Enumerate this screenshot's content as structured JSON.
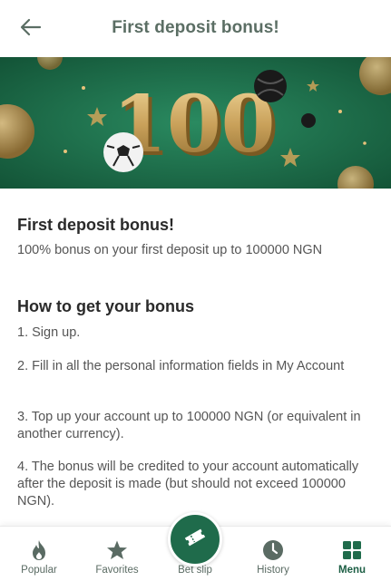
{
  "header": {
    "title": "First deposit bonus!",
    "back_icon": "arrow-left-icon"
  },
  "banner": {
    "text": "100",
    "background": "#1d6b4a",
    "accent": "#c9a15a"
  },
  "content": {
    "title": "First deposit bonus!",
    "subtitle": "100% bonus on your first deposit up to 100000 NGN",
    "how_title": "How to get your bonus",
    "steps": [
      "1. Sign up.",
      "2. Fill in all the personal information fields in My Account",
      "3. Top up your account up to 100000 NGN (or equivalent in another currency).",
      "4. The bonus will be credited to your account automatically after the deposit is made (but should not exceed 100000 NGN)."
    ]
  },
  "tabbar": {
    "items": [
      {
        "label": "Popular",
        "icon": "flame-icon"
      },
      {
        "label": "Favorites",
        "icon": "star-icon"
      },
      {
        "label": "Bet slip",
        "icon": "ticket-icon"
      },
      {
        "label": "History",
        "icon": "clock-icon"
      },
      {
        "label": "Menu",
        "icon": "grid-icon",
        "active": true
      }
    ]
  },
  "colors": {
    "primary": "#1f6b4b",
    "title_gray": "#5b6e64",
    "text": "#2b2b2b",
    "muted": "#555555"
  }
}
